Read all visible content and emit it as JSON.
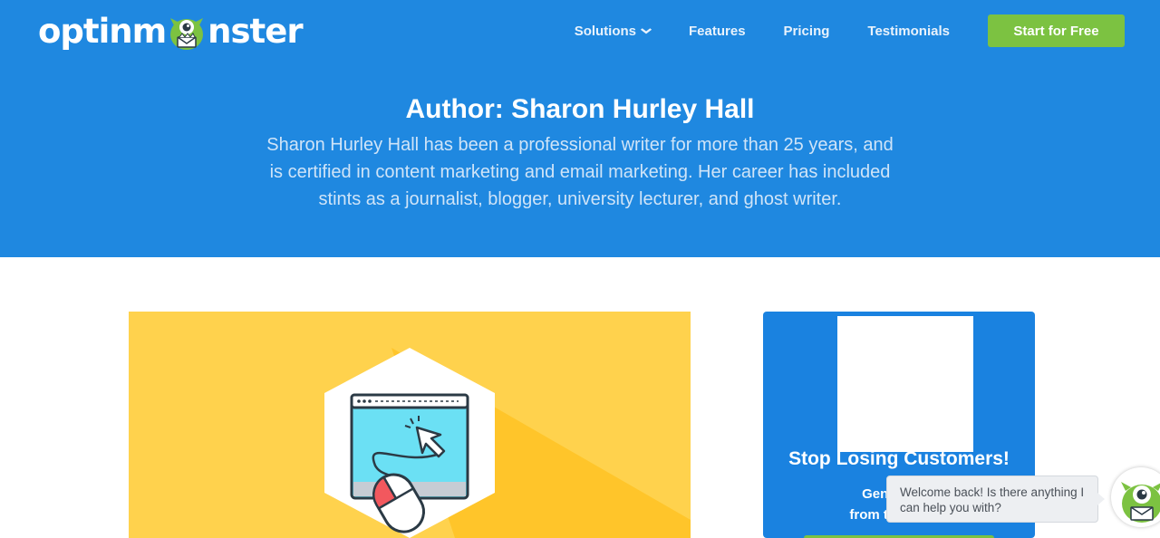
{
  "header": {
    "logo_text_left": "optinm",
    "logo_text_right": "nster",
    "logo_icon": "monster-mascot-icon",
    "nav": [
      {
        "label": "Solutions",
        "has_dropdown": true
      },
      {
        "label": "Features",
        "has_dropdown": false
      },
      {
        "label": "Pricing",
        "has_dropdown": false
      },
      {
        "label": "Testimonials",
        "has_dropdown": false
      }
    ],
    "cta_label": "Start for Free",
    "dropdown_icon": "chevron-down-icon"
  },
  "hero": {
    "title": "Author: Sharon Hurley Hall",
    "bio_lines": [
      "Sharon Hurley Hall has been a professional writer for more than 25 years, and",
      "is certified in content marketing and email marketing. Her career has included",
      "stints as a journalist, blogger, university lecturer, and ghost writer."
    ]
  },
  "feature_image": {
    "icon": "browser-mouse-click-icon"
  },
  "widget": {
    "title": "Stop Losing Customers!",
    "sub_line1": "Generate M",
    "sub_line2": "from the Traffic"
  },
  "chat": {
    "message": "Welcome back! Is there anything I can help you with?",
    "avatar_icon": "monster-mascot-icon"
  },
  "colors": {
    "brand_blue": "#1f88e0",
    "cta_green": "#7cc241",
    "feature_yellow": "#ffd24d"
  }
}
